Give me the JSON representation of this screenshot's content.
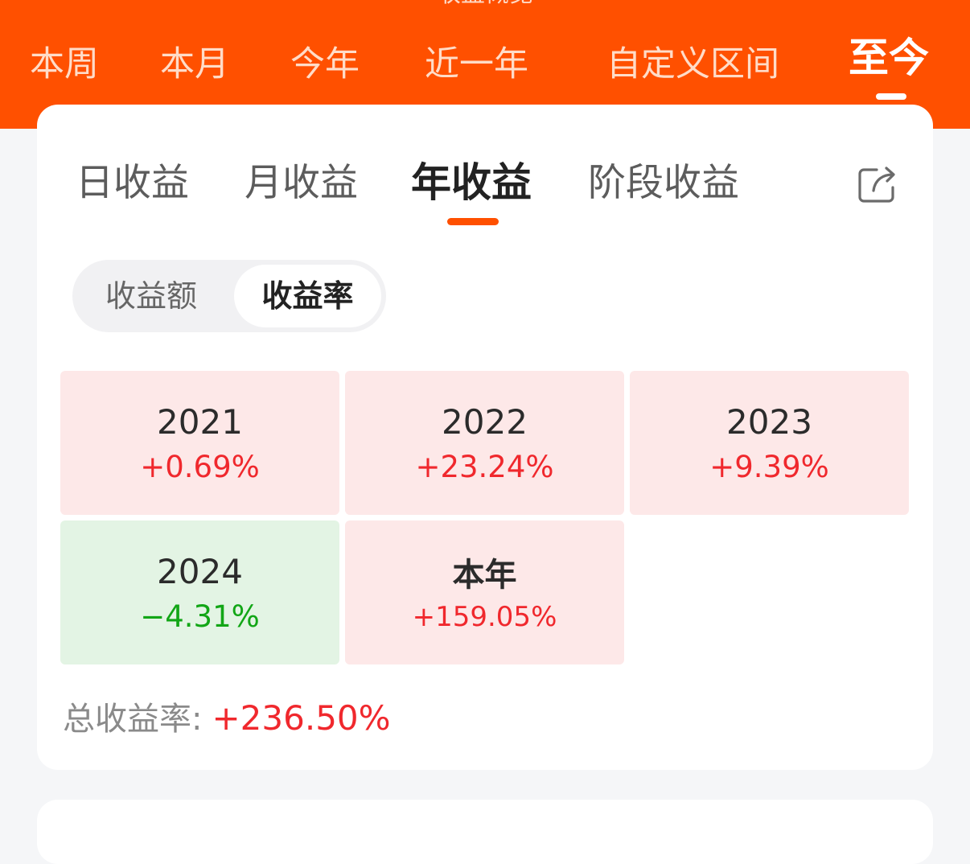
{
  "header": {
    "cut_title": "收益概览",
    "period_tabs": [
      "本周",
      "本月",
      "今年",
      "近一年",
      "自定义区间",
      "至今"
    ],
    "active_period": "至今"
  },
  "earnings_tabs": {
    "items": [
      "日收益",
      "月收益",
      "年收益",
      "阶段收益"
    ],
    "active": "年收益",
    "share_icon": "share-icon"
  },
  "toggle": {
    "options": [
      "收益额",
      "收益率"
    ],
    "selected": "收益率"
  },
  "years": [
    {
      "label": "2021",
      "rate": "+0.69%"
    },
    {
      "label": "2022",
      "rate": "+23.24%"
    },
    {
      "label": "2023",
      "rate": "+9.39%"
    },
    {
      "label": "2024",
      "rate": "−4.31%"
    },
    {
      "label": "本年",
      "rate": "+159.05%"
    }
  ],
  "total": {
    "label": "总收益率:",
    "value": "+236.50%"
  },
  "colors": {
    "brand_orange": "#ff5000",
    "positive_red": "#f0282d",
    "negative_green": "#12a616",
    "positive_bg": "#fde8e8",
    "negative_bg": "#e3f4e4"
  }
}
